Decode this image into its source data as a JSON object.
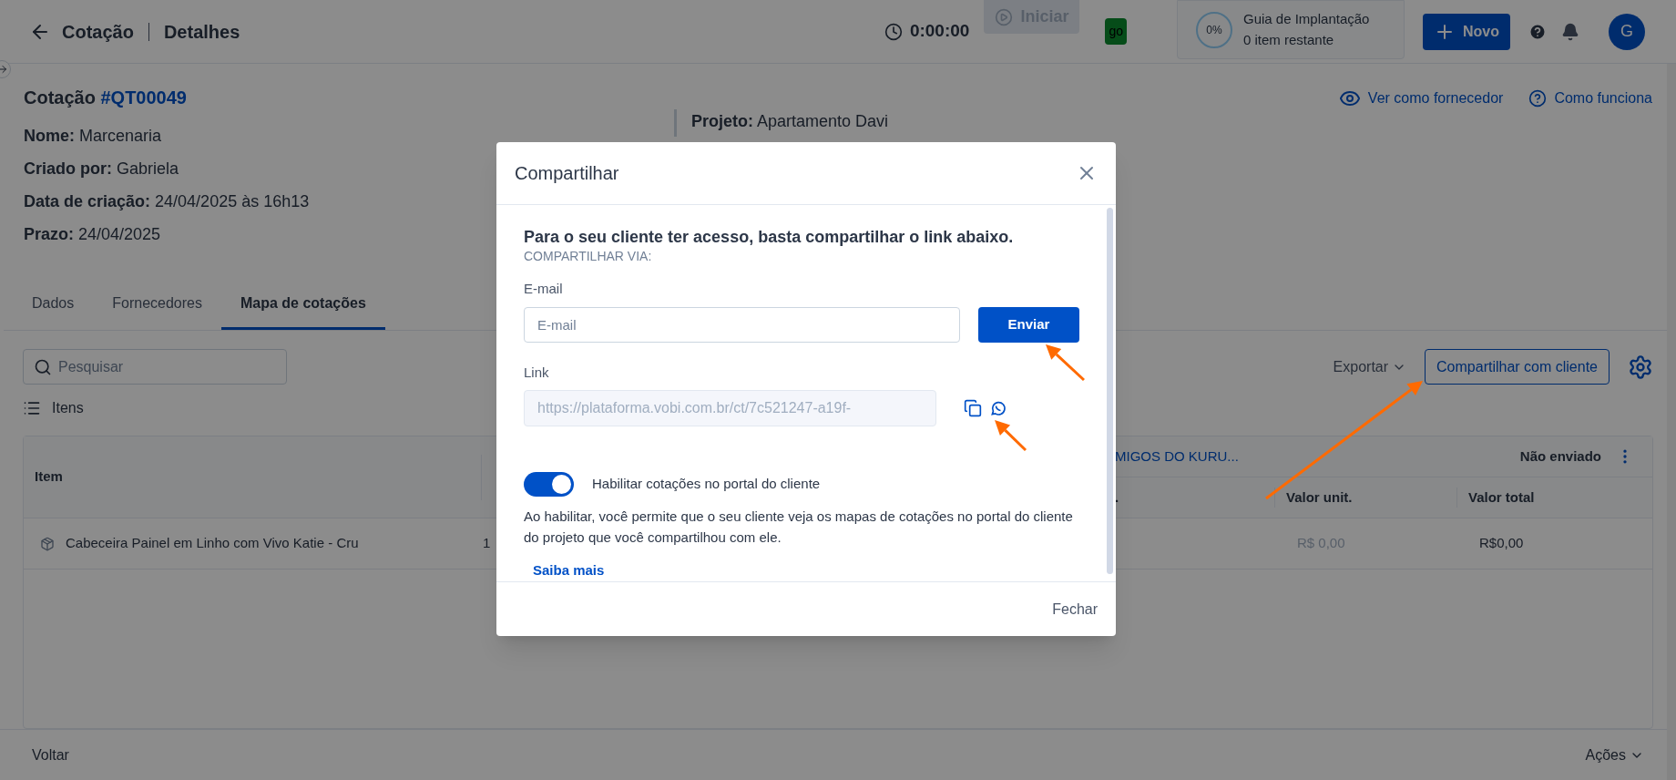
{
  "header": {
    "back": "Cotação",
    "title": "Detalhes",
    "timer": "0:00:00",
    "start_button": {
      "label": "Iniciar",
      "disabled": true
    },
    "badge": "go",
    "guide": {
      "percent": "0%",
      "title": "Guia de Implantação",
      "subtitle": "0 item restante"
    },
    "new_button": "Novo",
    "avatar": "G"
  },
  "quote": {
    "label": "Cotação",
    "code": "#QT00049",
    "fields": [
      {
        "label": "Nome:",
        "value": "Marcenaria"
      },
      {
        "label": "Criado por:",
        "value": "Gabriela"
      },
      {
        "label": "Data de criação:",
        "value": "24/04/2025 às 16h13"
      },
      {
        "label": "Prazo:",
        "value": "24/04/2025"
      }
    ],
    "project": {
      "label": "Projeto:",
      "value": "Apartamento Davi"
    }
  },
  "links": [
    "Ver como fornecedor",
    "Como funciona"
  ],
  "tabs": [
    {
      "label": "Dados",
      "selected": false
    },
    {
      "label": "Fornecedores",
      "selected": false
    },
    {
      "label": "Mapa de cotações",
      "selected": true
    }
  ],
  "toolbar": {
    "search_placeholder": "Pesquisar",
    "export": "Exportar",
    "share": "Compartilhar com cliente",
    "items": "Itens"
  },
  "table": {
    "item_header": "Item",
    "supplier": "MIGOS DO KURU...",
    "status": "Não enviado",
    "sub_columns": [
      ".",
      "Valor unit.",
      "Valor total"
    ],
    "rows": [
      {
        "item": "Cabeceira Painel em Linho com Vivo Katie - Cru",
        "qty": "1",
        "unit": "R$ 0,00",
        "total": "R$0,00"
      }
    ]
  },
  "footer": {
    "back": "Voltar",
    "actions": "Ações"
  },
  "dialog": {
    "title": "Compartilhar",
    "heading": "Para o seu cliente ter acesso, basta compartilhar o link abaixo.",
    "via": "COMPARTILHAR VIA:",
    "email_label": "E-mail",
    "email_placeholder": "E-mail",
    "send": "Enviar",
    "link_label": "Link",
    "link_value": "https://plataforma.vobi.com.br/ct/7c521247-a19f-",
    "toggle": {
      "label": "Habilitar cotações no portal do cliente",
      "on": true
    },
    "description": "Ao habilitar, você permite que o seu cliente veja os mapas de cotações no portal do cliente do projeto que você compartilhou com ele.",
    "learn_more": "Saiba mais",
    "close": "Fechar"
  }
}
